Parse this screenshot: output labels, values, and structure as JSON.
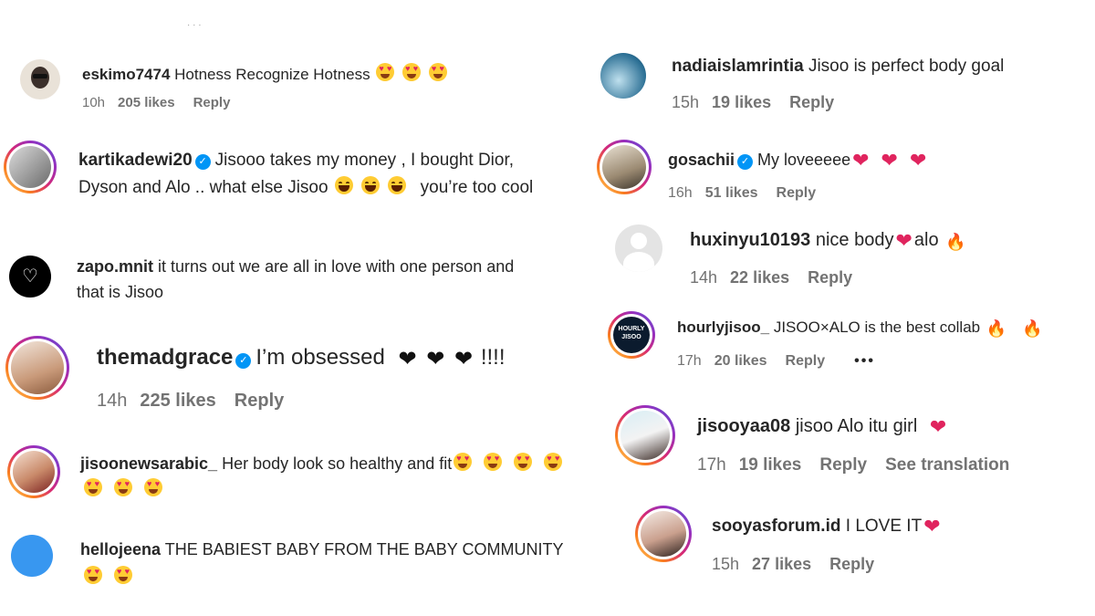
{
  "comments": [
    {
      "username": "eskimo7474",
      "text": "Hotness Recognize Hotness",
      "time": "10h",
      "likes": "205 likes",
      "reply": "Reply"
    },
    {
      "username": "kartikadewi20",
      "text1": "Jisooo takes my money , I bought Dior,",
      "text2a": "Dyson and Alo .. what else Jisoo",
      "text2b": "you’re too cool"
    },
    {
      "username": "zapo.mnit",
      "text1": "it turns out we are all in love with one person and",
      "text2": "that is Jisoo"
    },
    {
      "username": "themadgrace",
      "text": "I’m obsessed",
      "text_after": "!!!!",
      "time": "14h",
      "likes": "225 likes",
      "reply": "Reply"
    },
    {
      "username": "jisoonewsarabic_",
      "text": "Her body look so healthy and fit"
    },
    {
      "username": "hellojeena",
      "text": "THE BABIEST BABY FROM THE BABY COMMUNITY"
    },
    {
      "username": "nadiaislamrintia",
      "text": "Jisoo is perfect body goal",
      "time": "15h",
      "likes": "19 likes",
      "reply": "Reply"
    },
    {
      "username": "gosachii",
      "text": "My loveeeee",
      "time": "16h",
      "likes": "51 likes",
      "reply": "Reply"
    },
    {
      "username": "huxinyu10193",
      "text": "nice body",
      "text_after": "alo",
      "time": "14h",
      "likes": "22 likes",
      "reply": "Reply"
    },
    {
      "username": "hourlyjisoo_",
      "text": "JISOO×ALO is the best collab",
      "time": "17h",
      "likes": "20 likes",
      "reply": "Reply",
      "more": "•••",
      "avatar_text": "HOURLY JISOO"
    },
    {
      "username": "jisooyaa08",
      "text": "jisoo Alo itu girl",
      "time": "17h",
      "likes": "19 likes",
      "reply": "Reply",
      "translate": "See translation"
    },
    {
      "username": "sooyasforum.id",
      "text": "I LOVE IT",
      "time": "15h",
      "likes": "27 likes",
      "reply": "Reply"
    }
  ],
  "icons": {
    "verified": "✓",
    "heart_eyes": "heart-eyes-emoji",
    "grin": "grinning-sweat-emoji",
    "red_heart": "❤",
    "black_heart": "❤",
    "fire": "🔥",
    "outline_heart": "♡"
  },
  "colors": {
    "verified": "#0095f6",
    "meta": "#737373",
    "ring_start": "#feda75",
    "ring_end": "#4f5bd5"
  }
}
